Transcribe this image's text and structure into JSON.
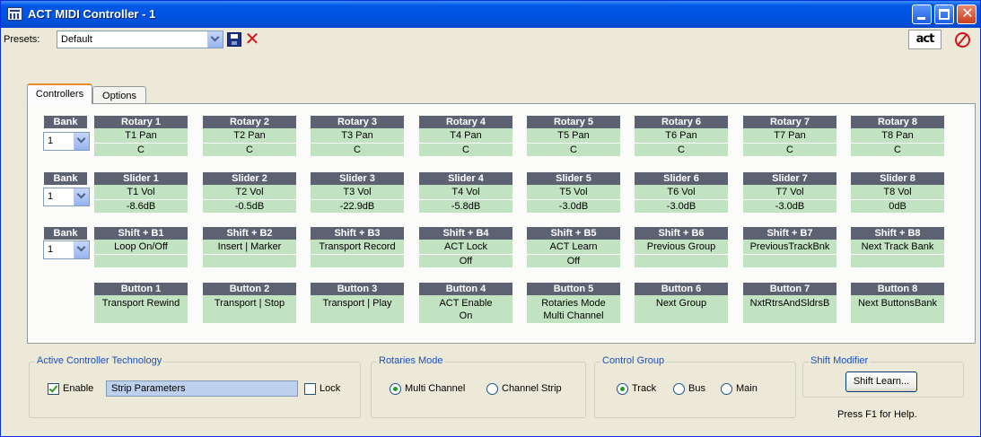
{
  "window": {
    "title": "ACT MIDI Controller - 1"
  },
  "presets": {
    "label": "Presets:",
    "value": "Default"
  },
  "toolbar": {
    "logo_text": "act"
  },
  "tabs": [
    {
      "label": "Controllers",
      "active": true
    },
    {
      "label": "Options",
      "active": false
    }
  ],
  "banks": [
    {
      "label": "Bank",
      "value": "1"
    },
    {
      "label": "Bank",
      "value": "1"
    },
    {
      "label": "Bank",
      "value": "1"
    }
  ],
  "rotaries": [
    {
      "header": "Rotary 1",
      "line1": "T1 Pan",
      "line2": "C"
    },
    {
      "header": "Rotary 2",
      "line1": "T2 Pan",
      "line2": "C"
    },
    {
      "header": "Rotary 3",
      "line1": "T3 Pan",
      "line2": "C"
    },
    {
      "header": "Rotary 4",
      "line1": "T4 Pan",
      "line2": "C"
    },
    {
      "header": "Rotary 5",
      "line1": "T5 Pan",
      "line2": "C"
    },
    {
      "header": "Rotary 6",
      "line1": "T6 Pan",
      "line2": "C"
    },
    {
      "header": "Rotary 7",
      "line1": "T7 Pan",
      "line2": "C"
    },
    {
      "header": "Rotary 8",
      "line1": "T8 Pan",
      "line2": "C"
    }
  ],
  "sliders": [
    {
      "header": "Slider 1",
      "line1": "T1 Vol",
      "line2": "-8.6dB"
    },
    {
      "header": "Slider 2",
      "line1": "T2 Vol",
      "line2": "-0.5dB"
    },
    {
      "header": "Slider 3",
      "line1": "T3 Vol",
      "line2": "-22.9dB"
    },
    {
      "header": "Slider 4",
      "line1": "T4 Vol",
      "line2": "-5.8dB"
    },
    {
      "header": "Slider 5",
      "line1": "T5 Vol",
      "line2": "-3.0dB"
    },
    {
      "header": "Slider 6",
      "line1": "T6 Vol",
      "line2": "-3.0dB"
    },
    {
      "header": "Slider 7",
      "line1": "T7 Vol",
      "line2": "-3.0dB"
    },
    {
      "header": "Slider 8",
      "line1": "T8 Vol",
      "line2": "0dB"
    }
  ],
  "shift_buttons": [
    {
      "header": "Shift + B1",
      "line1": "Loop On/Off",
      "line2": ""
    },
    {
      "header": "Shift + B2",
      "line1": "Insert | Marker",
      "line2": ""
    },
    {
      "header": "Shift + B3",
      "line1": "Transport Record",
      "line2": ""
    },
    {
      "header": "Shift + B4",
      "line1": "ACT Lock",
      "line2": "Off"
    },
    {
      "header": "Shift + B5",
      "line1": "ACT Learn",
      "line2": "Off"
    },
    {
      "header": "Shift + B6",
      "line1": "Previous Group",
      "line2": ""
    },
    {
      "header": "Shift + B7",
      "line1": "PreviousTrackBnk",
      "line2": ""
    },
    {
      "header": "Shift + B8",
      "line1": "Next Track Bank",
      "line2": ""
    }
  ],
  "buttons": [
    {
      "header": "Button 1",
      "line1": "Transport Rewind",
      "line2": ""
    },
    {
      "header": "Button 2",
      "line1": "Transport | Stop",
      "line2": ""
    },
    {
      "header": "Button 3",
      "line1": "Transport | Play",
      "line2": ""
    },
    {
      "header": "Button 4",
      "line1": "ACT Enable",
      "line2": "On"
    },
    {
      "header": "Button 5",
      "line1": "Rotaries Mode",
      "line2": "Multi Channel"
    },
    {
      "header": "Button 6",
      "line1": "Next Group",
      "line2": ""
    },
    {
      "header": "Button 7",
      "line1": "NxtRtrsAndSldrsB",
      "line2": ""
    },
    {
      "header": "Button 8",
      "line1": "Next ButtonsBank",
      "line2": ""
    }
  ],
  "act": {
    "title": "Active Controller Technology",
    "enable_label": "Enable",
    "enable_checked": true,
    "strip_value": "Strip Parameters",
    "lock_label": "Lock",
    "lock_checked": false
  },
  "rotaries_mode": {
    "title": "Rotaries Mode",
    "options": [
      {
        "label": "Multi Channel",
        "selected": true
      },
      {
        "label": "Channel Strip",
        "selected": false
      }
    ]
  },
  "control_group": {
    "title": "Control Group",
    "options": [
      {
        "label": "Track",
        "selected": true
      },
      {
        "label": "Bus",
        "selected": false
      },
      {
        "label": "Main",
        "selected": false
      }
    ]
  },
  "shift_modifier": {
    "title": "Shift Modifier",
    "button_label": "Shift Learn...",
    "help_text": "Press F1 for Help."
  },
  "colors": {
    "header_bg": "#5d6273",
    "field_bg": "#c2e3c2",
    "title_bar": "#0054e3",
    "group_title": "#1b4fbd",
    "check_green": "#21a121",
    "delete_red": "#d4141a"
  }
}
